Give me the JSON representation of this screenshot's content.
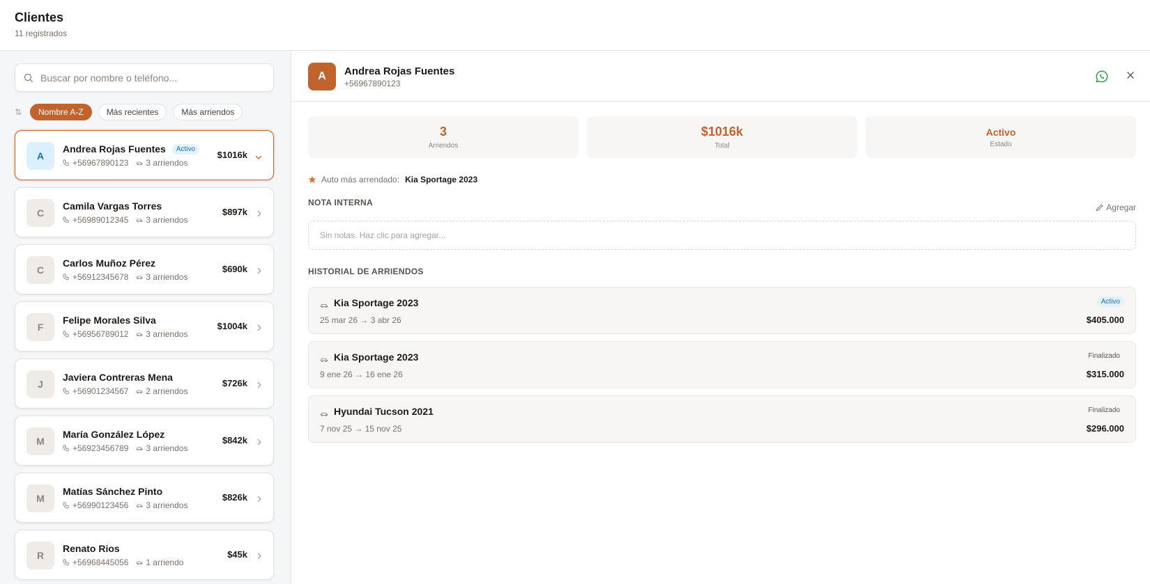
{
  "header": {
    "title": "Clientes",
    "subtitle": "11 registrados"
  },
  "search": {
    "placeholder": "Buscar por nombre o teléfono...",
    "value": ""
  },
  "sort": {
    "icon": "sort-arrows-icon",
    "options": [
      {
        "label": "Nombre A-Z",
        "active": true
      },
      {
        "label": "Más recientes",
        "active": false
      },
      {
        "label": "Más arriendos",
        "active": false
      }
    ]
  },
  "clients": [
    {
      "initial": "A",
      "name": "Andrea Rojas Fuentes",
      "badge": "Activo",
      "phone": "+56967890123",
      "rentals": "3 arriendos",
      "amount": "$1016k",
      "selected": true
    },
    {
      "initial": "C",
      "name": "Camila Vargas Torres",
      "badge": "",
      "phone": "+56989012345",
      "rentals": "3 arriendos",
      "amount": "$897k",
      "selected": false
    },
    {
      "initial": "C",
      "name": "Carlos Muñoz Pérez",
      "badge": "",
      "phone": "+56912345678",
      "rentals": "3 arriendos",
      "amount": "$690k",
      "selected": false
    },
    {
      "initial": "F",
      "name": "Felipe Morales Silva",
      "badge": "",
      "phone": "+56956789012",
      "rentals": "3 arriendos",
      "amount": "$1004k",
      "selected": false
    },
    {
      "initial": "J",
      "name": "Javiera Contreras Mena",
      "badge": "",
      "phone": "+56901234567",
      "rentals": "2 arriendos",
      "amount": "$726k",
      "selected": false
    },
    {
      "initial": "M",
      "name": "María González López",
      "badge": "",
      "phone": "+56923456789",
      "rentals": "3 arriendos",
      "amount": "$842k",
      "selected": false
    },
    {
      "initial": "M",
      "name": "Matías Sánchez Pinto",
      "badge": "",
      "phone": "+56990123456",
      "rentals": "3 arriendos",
      "amount": "$826k",
      "selected": false
    },
    {
      "initial": "R",
      "name": "Renato Rios",
      "badge": "",
      "phone": "+56968445056",
      "rentals": "1 arriendo",
      "amount": "$45k",
      "selected": false
    }
  ],
  "detail": {
    "initial": "A",
    "name": "Andrea Rojas Fuentes",
    "phone": "+56967890123",
    "stats": [
      {
        "value": "3",
        "label": "Arriendos"
      },
      {
        "value": "$1016k",
        "label": "Total"
      },
      {
        "value": "Activo",
        "label": "Estado"
      }
    ],
    "favorite_label": "Auto más arrendado:",
    "favorite_value": "Kia Sportage 2023",
    "note_title": "NOTA INTERNA",
    "note_add": "Agregar",
    "note_placeholder": "Sin notas. Haz clic para agregar...",
    "history_title": "HISTORIAL DE ARRIENDOS",
    "history": [
      {
        "car": "Kia Sportage 2023",
        "dates": "25 mar 26 → 3 abr 26",
        "status": "Activo",
        "active": true,
        "amount": "$405.000"
      },
      {
        "car": "Kia Sportage 2023",
        "dates": "9 ene 26 → 16 ene 26",
        "status": "Finalizado",
        "active": false,
        "amount": "$315.000"
      },
      {
        "car": "Hyundai Tucson 2021",
        "dates": "7 nov 25 → 15 nov 25",
        "status": "Finalizado",
        "active": false,
        "amount": "$296.000"
      }
    ]
  },
  "colors": {
    "accent": "#c2622d",
    "active_badge_bg": "#e2f1fc",
    "active_badge_text": "#1e6fa8",
    "whatsapp": "#25a244"
  }
}
